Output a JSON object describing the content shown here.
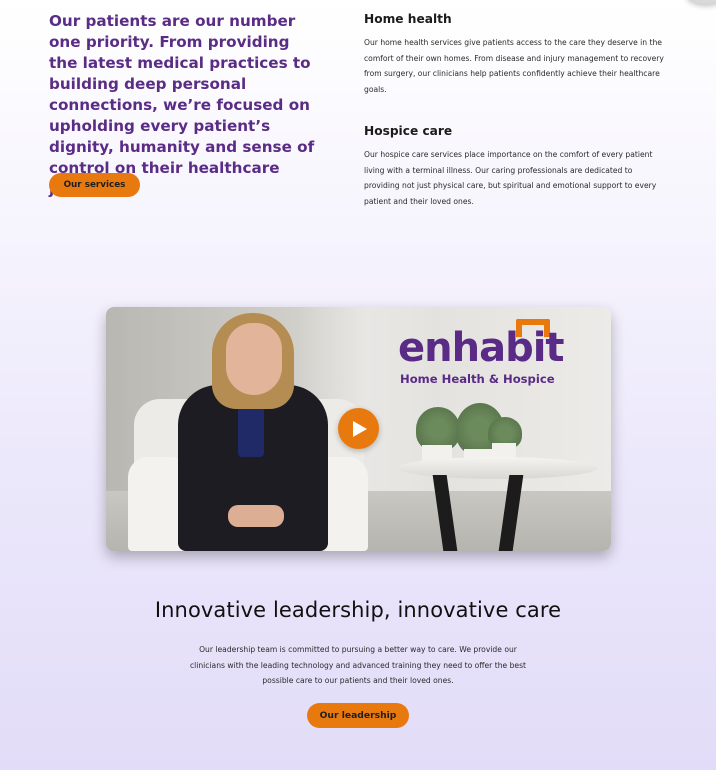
{
  "intro": {
    "text": "Our patients are our number one priority. From providing the latest medical practices to building deep personal connections, we’re focused on upholding every patient’s dignity, humanity and sense of control on their healthcare journey.",
    "button_label": "Our services"
  },
  "services": [
    {
      "title": "Home health",
      "description": "Our home health services give patients access to the care they deserve in the comfort of their own homes. From disease and injury management to recovery from surgery, our clinicians help patients confidently achieve their healthcare goals."
    },
    {
      "title": "Hospice care",
      "description": "Our hospice care services place importance on the comfort of every patient living with a terminal illness. Our caring professionals are dedicated to providing not just physical care, but spiritual and emotional support to every patient and their loved ones."
    }
  ],
  "video": {
    "logo_word": "enhabit",
    "logo_subtitle": "Home Health & Hospice",
    "play_icon": "play-icon"
  },
  "leadership": {
    "title": "Innovative leadership, innovative care",
    "text": "Our leadership team is committed to pursuing a better way to care. We provide our clinicians with the leading technology and advanced training they need to offer the best possible care to our patients and their loved ones.",
    "button_label": "Our leadership"
  },
  "colors": {
    "brand_purple": "#5b2c86",
    "accent_orange": "#e8790f"
  }
}
